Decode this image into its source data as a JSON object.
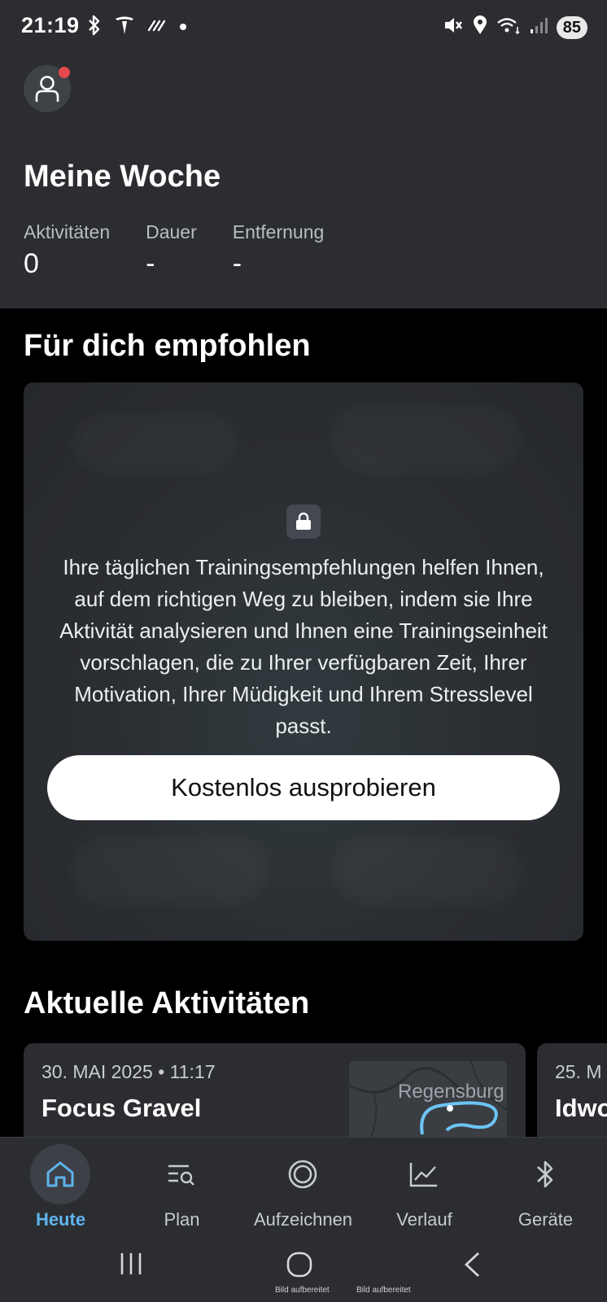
{
  "status_bar": {
    "time": "21:19",
    "battery": "85"
  },
  "week": {
    "title": "Meine Woche",
    "stats": [
      {
        "label": "Aktivitäten",
        "value": "0"
      },
      {
        "label": "Dauer",
        "value": "-"
      },
      {
        "label": "Entfernung",
        "value": "-"
      }
    ]
  },
  "recommended": {
    "title": "Für dich empfohlen",
    "lock_icon": "lock-icon",
    "description": "Ihre täglichen Trainingsempfehlungen helfen Ihnen, auf dem richtigen Weg zu bleiben, indem sie Ihre Aktivität analysieren und Ihnen eine Trainingseinheit vorschlagen, die zu Ihrer verfügbaren Zeit, Ihrer Motivation, Ihrer Müdigkeit und Ihrem Stresslevel passt.",
    "button": "Kostenlos ausprobieren"
  },
  "activities": {
    "title": "Aktuelle Aktivitäten",
    "items": [
      {
        "date": "30. MAI 2025 • 11:17",
        "name": "Focus Gravel",
        "map_label": "Regensburg"
      },
      {
        "date": "25. M",
        "name": "Idwo"
      }
    ]
  },
  "nav": {
    "items": [
      {
        "label": "Heute",
        "icon": "home-icon",
        "active": true
      },
      {
        "label": "Plan",
        "icon": "plan-icon"
      },
      {
        "label": "Aufzeichnen",
        "icon": "record-icon"
      },
      {
        "label": "Verlauf",
        "icon": "chart-icon"
      },
      {
        "label": "Geräte",
        "icon": "bluetooth-icon"
      }
    ]
  },
  "system_nav": {
    "caption_1": "Bild aufbereitet",
    "caption_2": "Bild aufbereitet"
  },
  "colors": {
    "accent": "#5fb4ee",
    "header_bg": "#2b2d31",
    "notification_dot": "#e5484d"
  }
}
